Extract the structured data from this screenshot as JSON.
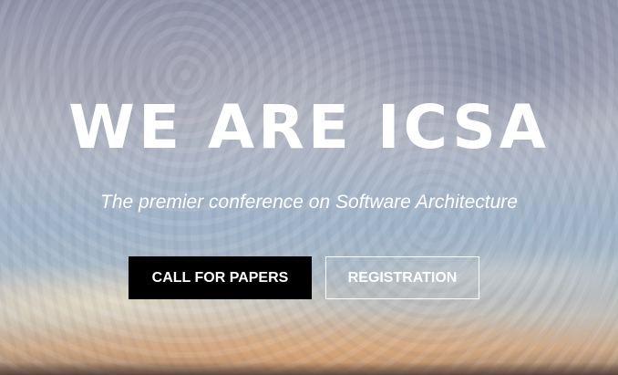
{
  "hero": {
    "title": "WE ARE ICSA",
    "subtitle": "The premier conference on Software Architecture",
    "buttons": {
      "call_for_papers": "CALL FOR PAPERS",
      "registration": "REGISTRATION"
    }
  },
  "colors": {
    "primary_button_bg": "#000000",
    "text": "#ffffff",
    "outline_border": "#ffffff"
  }
}
